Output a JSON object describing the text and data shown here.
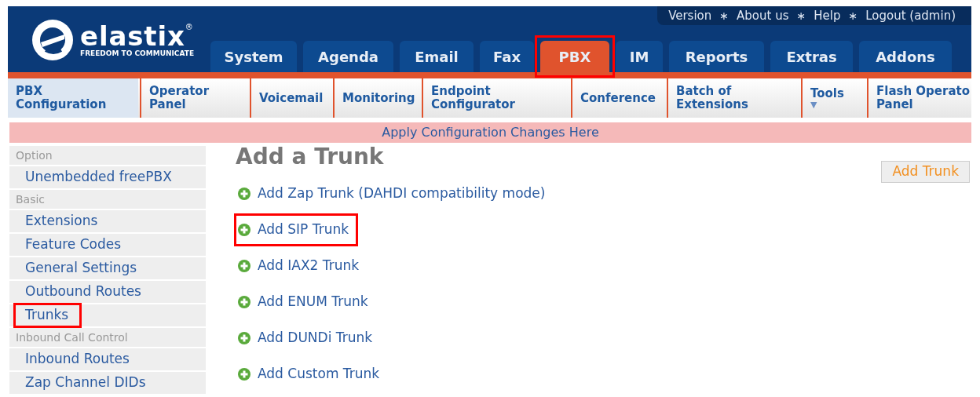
{
  "logo": {
    "name": "elastix",
    "registered": "®",
    "tagline": "FREEDOM TO COMMUNICATE"
  },
  "top_links": [
    {
      "label": "Version"
    },
    {
      "label": "About us"
    },
    {
      "label": "Help"
    },
    {
      "label": "Logout (admin)"
    }
  ],
  "top_link_separator": "∗",
  "tabs": [
    {
      "label": "System",
      "selected": false,
      "highlighted": false
    },
    {
      "label": "Agenda",
      "selected": false,
      "highlighted": false
    },
    {
      "label": "Email",
      "selected": false,
      "highlighted": false
    },
    {
      "label": "Fax",
      "selected": false,
      "highlighted": false
    },
    {
      "label": "PBX",
      "selected": true,
      "highlighted": true
    },
    {
      "label": "IM",
      "selected": false,
      "highlighted": false
    },
    {
      "label": "Reports",
      "selected": false,
      "highlighted": false
    },
    {
      "label": "Extras",
      "selected": false,
      "highlighted": false
    },
    {
      "label": "Addons",
      "selected": false,
      "highlighted": false
    }
  ],
  "submenu": [
    {
      "lines": [
        "PBX",
        "Configuration"
      ],
      "selected": true
    },
    {
      "lines": [
        "Operator",
        "Panel"
      ],
      "selected": false
    },
    {
      "lines": [
        "Voicemail"
      ],
      "selected": false
    },
    {
      "lines": [
        "Monitoring"
      ],
      "selected": false
    },
    {
      "lines": [
        "Endpoint",
        "Configurator"
      ],
      "selected": false
    },
    {
      "lines": [
        "Conference"
      ],
      "selected": false
    },
    {
      "lines": [
        "Batch of",
        "Extensions"
      ],
      "selected": false
    },
    {
      "lines": [
        "Tools"
      ],
      "caret": "▼",
      "selected": false
    },
    {
      "lines": [
        "Flash Operato",
        "Panel"
      ],
      "selected": false
    }
  ],
  "apply_bar": "Apply Configuration Changes Here",
  "sidebar": [
    {
      "kind": "header",
      "label": "Option"
    },
    {
      "kind": "link",
      "label": "Unembedded freePBX",
      "highlighted": false
    },
    {
      "kind": "header",
      "label": "Basic"
    },
    {
      "kind": "link",
      "label": "Extensions",
      "highlighted": false
    },
    {
      "kind": "link",
      "label": "Feature Codes",
      "highlighted": false
    },
    {
      "kind": "link",
      "label": "General Settings",
      "highlighted": false
    },
    {
      "kind": "link",
      "label": "Outbound Routes",
      "highlighted": false
    },
    {
      "kind": "link",
      "label": "Trunks",
      "highlighted": true
    },
    {
      "kind": "header",
      "label": "Inbound Call Control"
    },
    {
      "kind": "link",
      "label": "Inbound Routes",
      "highlighted": false
    },
    {
      "kind": "link",
      "label": "Zap Channel DIDs",
      "highlighted": false
    }
  ],
  "content": {
    "title": "Add a Trunk",
    "button": "Add Trunk",
    "links": [
      {
        "label": "Add Zap Trunk (DAHDI compatibility mode)",
        "highlighted": false
      },
      {
        "label": "Add SIP Trunk",
        "highlighted": true
      },
      {
        "label": "Add IAX2 Trunk",
        "highlighted": false
      },
      {
        "label": "Add ENUM Trunk",
        "highlighted": false
      },
      {
        "label": "Add DUNDi Trunk",
        "highlighted": false
      },
      {
        "label": "Add Custom Trunk",
        "highlighted": false
      }
    ]
  }
}
